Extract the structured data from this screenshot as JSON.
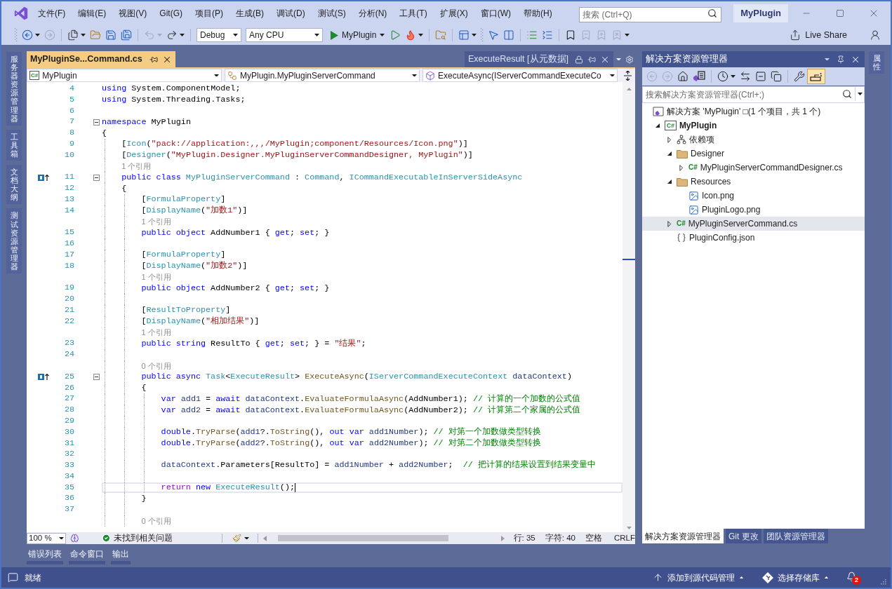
{
  "title_bar": {
    "menu": [
      "文件(F)",
      "编辑(E)",
      "视图(V)",
      "Git(G)",
      "项目(P)",
      "生成(B)",
      "调试(D)",
      "测试(S)",
      "分析(N)",
      "工具(T)",
      "扩展(X)",
      "窗口(W)",
      "帮助(H)"
    ],
    "search": {
      "placeholder": "搜索 (Ctrl+Q)"
    },
    "solution_name": "MyPlugin"
  },
  "toolbar": {
    "groups": [
      {
        "items": [
          {
            "kind": "button",
            "disabled": false,
            "dropdown": true
          },
          {
            "kind": "button",
            "disabled": true,
            "dropdown": false
          }
        ]
      },
      {
        "items": [
          {
            "kind": "button",
            "disabled": false,
            "dropdown": true
          },
          {
            "kind": "button",
            "disabled": false,
            "dropdown": false
          },
          {
            "kind": "button",
            "disabled": false,
            "dropdown": false
          },
          {
            "kind": "button",
            "disabled": false,
            "dropdown": false
          }
        ]
      },
      {
        "items": [
          {
            "kind": "button",
            "disabled": true,
            "dropdown": true
          },
          {
            "kind": "button",
            "disabled": false,
            "dropdown": true
          }
        ]
      },
      {
        "items": [
          {
            "kind": "combo",
            "value": "Debug"
          },
          {
            "kind": "combo",
            "value": "Any CPU"
          },
          {
            "kind": "start",
            "label": "MyPlugin",
            "dropdown": true
          },
          {
            "kind": "button",
            "disabled": false,
            "dropdown": false
          },
          {
            "kind": "button",
            "disabled": false,
            "dropdown": true
          }
        ]
      },
      {
        "items": [
          {
            "kind": "button",
            "disabled": false,
            "dropdown": false
          }
        ]
      },
      {
        "items": [
          {
            "kind": "button",
            "disabled": false,
            "dropdown": true
          }
        ]
      },
      {
        "items": [
          {
            "kind": "button",
            "disabled": false,
            "dropdown": false
          },
          {
            "kind": "button",
            "disabled": false,
            "dropdown": false
          }
        ]
      },
      {
        "items": [
          {
            "kind": "button",
            "disabled": false,
            "dropdown": false
          },
          {
            "kind": "button",
            "disabled": false,
            "dropdown": false
          }
        ]
      },
      {
        "items": [
          {
            "kind": "button",
            "disabled": false,
            "dropdown": false
          },
          {
            "kind": "button",
            "disabled": true,
            "dropdown": false
          },
          {
            "kind": "button",
            "disabled": true,
            "dropdown": false
          },
          {
            "kind": "button",
            "disabled": true,
            "dropdown": false
          }
        ]
      }
    ],
    "live_share": "Live Share"
  },
  "left_tool_tabs": [
    "服务器资源管理器",
    "工具箱",
    "文档大纲",
    "测试资源管理器"
  ],
  "editor": {
    "tabs": [
      {
        "kind": "document",
        "label": "MyPluginSe...Command.cs",
        "selected": true
      },
      {
        "kind": "preview",
        "label": "ExecuteResult [从元数据]",
        "selected": false
      }
    ],
    "navigation": [
      {
        "kind": "project",
        "badge": "C#",
        "value": "MyPlugin"
      },
      {
        "kind": "class",
        "value": "MyPlugin.MyPluginServerCommand"
      },
      {
        "kind": "method",
        "value": "ExecuteAsync(IServerCommandExecuteCo"
      }
    ],
    "lines": [
      {
        "kind": "code",
        "number": "4",
        "segments": [
          {
            "text": "using",
            "kind": "keyword"
          },
          {
            "text": " System.ComponentModel;",
            "kind": "plain"
          }
        ]
      },
      {
        "kind": "code",
        "number": "5",
        "segments": [
          {
            "text": "using",
            "kind": "keyword"
          },
          {
            "text": " System.Threading.Tasks;",
            "kind": "plain"
          }
        ]
      },
      {
        "kind": "code",
        "number": "6"
      },
      {
        "kind": "code",
        "number": "7",
        "expanded": true,
        "segments": [
          {
            "text": "namespace",
            "kind": "keyword"
          },
          {
            "text": " MyPlugin",
            "kind": "plain"
          }
        ]
      },
      {
        "kind": "code",
        "number": "8",
        "segments": [
          {
            "text": "{",
            "kind": "plain"
          }
        ]
      },
      {
        "kind": "code",
        "number": "9",
        "segments": [
          {
            "text": "    [",
            "kind": "plain"
          },
          {
            "text": "Icon",
            "kind": "type"
          },
          {
            "text": "(",
            "kind": "plain"
          },
          {
            "text": "\"pack://application:,,,/MyPlugin;component/Resources/Icon.png\"",
            "kind": "string"
          },
          {
            "text": ")]",
            "kind": "plain"
          }
        ]
      },
      {
        "kind": "code",
        "number": "10",
        "segments": [
          {
            "text": "    [",
            "kind": "plain"
          },
          {
            "text": "Designer",
            "kind": "type"
          },
          {
            "text": "(",
            "kind": "plain"
          },
          {
            "text": "\"MyPlugin.Designer.MyPluginServerCommandDesigner, MyPlugin\"",
            "kind": "string"
          },
          {
            "text": ")]",
            "kind": "plain"
          }
        ]
      },
      {
        "kind": "codelens",
        "text": "1 个引用"
      },
      {
        "kind": "code",
        "number": "11",
        "glyph": true,
        "expanded": true,
        "segments": [
          {
            "text": "    public",
            "kind": "keyword"
          },
          {
            "text": " class",
            "kind": "keyword"
          },
          {
            "text": " MyPluginServerCommand",
            "kind": "type"
          },
          {
            "text": " : ",
            "kind": "plain"
          },
          {
            "text": "Command",
            "kind": "type"
          },
          {
            "text": ", ",
            "kind": "plain"
          },
          {
            "text": "ICommandExecutableInServerSideAsync",
            "kind": "type"
          }
        ]
      },
      {
        "kind": "code",
        "number": "12",
        "segments": [
          {
            "text": "    {",
            "kind": "plain"
          }
        ]
      },
      {
        "kind": "code",
        "number": "13",
        "segments": [
          {
            "text": "        [",
            "kind": "plain"
          },
          {
            "text": "FormulaProperty",
            "kind": "type"
          },
          {
            "text": "]",
            "kind": "plain"
          }
        ]
      },
      {
        "kind": "code",
        "number": "14",
        "segments": [
          {
            "text": "        [",
            "kind": "plain"
          },
          {
            "text": "DisplayName",
            "kind": "type"
          },
          {
            "text": "(",
            "kind": "plain"
          },
          {
            "text": "\"加数1\"",
            "kind": "string"
          },
          {
            "text": ")]",
            "kind": "plain"
          }
        ]
      },
      {
        "kind": "codelens",
        "text": "1 个引用"
      },
      {
        "kind": "code",
        "number": "15",
        "segments": [
          {
            "text": "        public",
            "kind": "keyword"
          },
          {
            "text": " object",
            "kind": "keyword"
          },
          {
            "text": " AddNumber1 { ",
            "kind": "plain"
          },
          {
            "text": "get",
            "kind": "keyword"
          },
          {
            "text": "; ",
            "kind": "plain"
          },
          {
            "text": "set",
            "kind": "keyword"
          },
          {
            "text": "; }",
            "kind": "plain"
          }
        ]
      },
      {
        "kind": "code",
        "number": "16"
      },
      {
        "kind": "code",
        "number": "17",
        "segments": [
          {
            "text": "        [",
            "kind": "plain"
          },
          {
            "text": "FormulaProperty",
            "kind": "type"
          },
          {
            "text": "]",
            "kind": "plain"
          }
        ]
      },
      {
        "kind": "code",
        "number": "18",
        "segments": [
          {
            "text": "        [",
            "kind": "plain"
          },
          {
            "text": "DisplayName",
            "kind": "type"
          },
          {
            "text": "(",
            "kind": "plain"
          },
          {
            "text": "\"加数2\"",
            "kind": "string"
          },
          {
            "text": ")]",
            "kind": "plain"
          }
        ]
      },
      {
        "kind": "codelens",
        "text": "1 个引用"
      },
      {
        "kind": "code",
        "number": "19",
        "segments": [
          {
            "text": "        public",
            "kind": "keyword"
          },
          {
            "text": " object",
            "kind": "keyword"
          },
          {
            "text": " AddNumber2 { ",
            "kind": "plain"
          },
          {
            "text": "get",
            "kind": "keyword"
          },
          {
            "text": "; ",
            "kind": "plain"
          },
          {
            "text": "set",
            "kind": "keyword"
          },
          {
            "text": "; }",
            "kind": "plain"
          }
        ]
      },
      {
        "kind": "code",
        "number": "20"
      },
      {
        "kind": "code",
        "number": "21",
        "segments": [
          {
            "text": "        [",
            "kind": "plain"
          },
          {
            "text": "ResultToProperty",
            "kind": "type"
          },
          {
            "text": "]",
            "kind": "plain"
          }
        ]
      },
      {
        "kind": "code",
        "number": "22",
        "segments": [
          {
            "text": "        [",
            "kind": "plain"
          },
          {
            "text": "DisplayName",
            "kind": "type"
          },
          {
            "text": "(",
            "kind": "plain"
          },
          {
            "text": "\"相加结果\"",
            "kind": "string"
          },
          {
            "text": ")]",
            "kind": "plain"
          }
        ]
      },
      {
        "kind": "codelens",
        "text": "1 个引用"
      },
      {
        "kind": "code",
        "number": "23",
        "segments": [
          {
            "text": "        public",
            "kind": "keyword"
          },
          {
            "text": " string",
            "kind": "keyword"
          },
          {
            "text": " ResultTo { ",
            "kind": "plain"
          },
          {
            "text": "get",
            "kind": "keyword"
          },
          {
            "text": "; ",
            "kind": "plain"
          },
          {
            "text": "set",
            "kind": "keyword"
          },
          {
            "text": "; } = ",
            "kind": "plain"
          },
          {
            "text": "\"结果\"",
            "kind": "string"
          },
          {
            "text": ";",
            "kind": "plain"
          }
        ]
      },
      {
        "kind": "code",
        "number": "24"
      },
      {
        "kind": "codelens",
        "text": "0 个引用"
      },
      {
        "kind": "code",
        "number": "25",
        "glyph": true,
        "expanded": true,
        "segments": [
          {
            "text": "        public",
            "kind": "keyword"
          },
          {
            "text": " async",
            "kind": "keyword"
          },
          {
            "text": " Task",
            "kind": "type"
          },
          {
            "text": "<",
            "kind": "plain"
          },
          {
            "text": "ExecuteResult",
            "kind": "type"
          },
          {
            "text": "> ",
            "kind": "plain"
          },
          {
            "text": "ExecuteAsync",
            "kind": "method"
          },
          {
            "text": "(",
            "kind": "plain"
          },
          {
            "text": "IServerCommandExecuteContext",
            "kind": "type"
          },
          {
            "text": " dataContext",
            "kind": "variable"
          },
          {
            "text": ")",
            "kind": "plain"
          }
        ]
      },
      {
        "kind": "code",
        "number": "26",
        "segments": [
          {
            "text": "        {",
            "kind": "plain"
          }
        ]
      },
      {
        "kind": "code",
        "number": "27",
        "segments": [
          {
            "text": "            var",
            "kind": "keyword"
          },
          {
            "text": " add1",
            "kind": "variable"
          },
          {
            "text": " = ",
            "kind": "plain"
          },
          {
            "text": "await",
            "kind": "keyword"
          },
          {
            "text": " dataContext",
            "kind": "variable"
          },
          {
            "text": ".",
            "kind": "plain"
          },
          {
            "text": "EvaluateFormulaAsync",
            "kind": "method"
          },
          {
            "text": "(AddNumber1); ",
            "kind": "plain"
          },
          {
            "text": "// 计算的一个加数的公式值",
            "kind": "comment"
          }
        ]
      },
      {
        "kind": "code",
        "number": "28",
        "segments": [
          {
            "text": "            var",
            "kind": "keyword"
          },
          {
            "text": " add2",
            "kind": "variable"
          },
          {
            "text": " = ",
            "kind": "plain"
          },
          {
            "text": "await",
            "kind": "keyword"
          },
          {
            "text": " dataContext",
            "kind": "variable"
          },
          {
            "text": ".",
            "kind": "plain"
          },
          {
            "text": "EvaluateFormulaAsync",
            "kind": "method"
          },
          {
            "text": "(AddNumber2); ",
            "kind": "plain"
          },
          {
            "text": "// 计算第二个家属的公式值",
            "kind": "comment"
          }
        ]
      },
      {
        "kind": "code",
        "number": "29"
      },
      {
        "kind": "code",
        "number": "30",
        "segments": [
          {
            "text": "            double",
            "kind": "keyword"
          },
          {
            "text": ".",
            "kind": "plain"
          },
          {
            "text": "TryParse",
            "kind": "method"
          },
          {
            "text": "(",
            "kind": "plain"
          },
          {
            "text": "add1",
            "kind": "variable"
          },
          {
            "text": "?.",
            "kind": "plain"
          },
          {
            "text": "ToString",
            "kind": "method"
          },
          {
            "text": "(), ",
            "kind": "plain"
          },
          {
            "text": "out",
            "kind": "keyword"
          },
          {
            "text": " var",
            "kind": "keyword"
          },
          {
            "text": " add1Number",
            "kind": "variable"
          },
          {
            "text": "); ",
            "kind": "plain"
          },
          {
            "text": "// 对第一个加数做类型转换",
            "kind": "comment"
          }
        ]
      },
      {
        "kind": "code",
        "number": "31",
        "segments": [
          {
            "text": "            double",
            "kind": "keyword"
          },
          {
            "text": ".",
            "kind": "plain"
          },
          {
            "text": "TryParse",
            "kind": "method"
          },
          {
            "text": "(",
            "kind": "plain"
          },
          {
            "text": "add2",
            "kind": "variable"
          },
          {
            "text": "?.",
            "kind": "plain"
          },
          {
            "text": "ToString",
            "kind": "method"
          },
          {
            "text": "(), ",
            "kind": "plain"
          },
          {
            "text": "out",
            "kind": "keyword"
          },
          {
            "text": " var",
            "kind": "keyword"
          },
          {
            "text": " add2Number",
            "kind": "variable"
          },
          {
            "text": "); ",
            "kind": "plain"
          },
          {
            "text": "// 对第二个加数做类型转换",
            "kind": "comment"
          }
        ]
      },
      {
        "kind": "code",
        "number": "32"
      },
      {
        "kind": "code",
        "number": "33",
        "segments": [
          {
            "text": "            dataContext",
            "kind": "variable"
          },
          {
            "text": ".Parameters[ResultTo] = ",
            "kind": "plain"
          },
          {
            "text": "add1Number",
            "kind": "variable"
          },
          {
            "text": " + ",
            "kind": "plain"
          },
          {
            "text": "add2Number",
            "kind": "variable"
          },
          {
            "text": ";  ",
            "kind": "plain"
          },
          {
            "text": "// 把计算的结果设置到结果变量中",
            "kind": "comment"
          }
        ]
      },
      {
        "kind": "code",
        "number": "34"
      },
      {
        "kind": "code",
        "number": "35",
        "current": true,
        "segments": [
          {
            "text": "            return",
            "kind": "control"
          },
          {
            "text": " new",
            "kind": "keyword"
          },
          {
            "text": " ExecuteResult",
            "kind": "type"
          },
          {
            "text": "();",
            "kind": "plain"
          }
        ]
      },
      {
        "kind": "code",
        "number": "36",
        "segments": [
          {
            "text": "        }",
            "kind": "plain"
          }
        ]
      },
      {
        "kind": "code",
        "number": "37"
      },
      {
        "kind": "codelens",
        "text": "0 个引用"
      }
    ],
    "status": {
      "zoom": "100 %",
      "issues": "未找到相关问题",
      "line": "行: 35",
      "column": "字符: 40",
      "indentation": "空格",
      "line_ending": "CRLF"
    }
  },
  "solution_explorer": {
    "title": "解决方案资源管理器",
    "toolbar": {
      "groups": [
        {
          "items": [
            {
              "disabled": true,
              "dropdown": false
            },
            {
              "disabled": true,
              "dropdown": false
            },
            {
              "disabled": false,
              "dropdown": false
            },
            {
              "disabled": false,
              "dropdown": false
            }
          ]
        },
        {
          "items": [
            {
              "disabled": false,
              "dropdown": true
            },
            {
              "disabled": false,
              "dropdown": false
            },
            {
              "disabled": false,
              "dropdown": false
            },
            {
              "disabled": false,
              "dropdown": false
            }
          ]
        },
        {
          "items": [
            {
              "disabled": false,
              "dropdown": false
            },
            {
              "disabled": false,
              "dropdown": false,
              "on": true
            }
          ]
        }
      ]
    },
    "search": {
      "placeholder": "搜索解决方案资源管理器(Ctrl+;)"
    },
    "tree": [
      {
        "kind": "solution",
        "label": "解决方案 'MyPlugin' □(1 个项目，共 1 个)",
        "selected": false,
        "children": [
          {
            "kind": "project",
            "badge": "C#",
            "label": "MyPlugin",
            "expanded": true,
            "selected": false,
            "children": [
              {
                "kind": "dependencies",
                "label": "依赖项",
                "expanded": false,
                "selected": false
              },
              {
                "kind": "folder",
                "label": "Designer",
                "expanded": true,
                "selected": false,
                "children": [
                  {
                    "kind": "csharp",
                    "badge": "C#",
                    "label": "MyPluginServerCommandDesigner.cs",
                    "expanded": false,
                    "selected": false
                  }
                ]
              },
              {
                "kind": "folder",
                "label": "Resources",
                "expanded": true,
                "selected": false,
                "children": [
                  {
                    "kind": "image",
                    "label": "Icon.png",
                    "selected": false
                  },
                  {
                    "kind": "image",
                    "label": "PluginLogo.png",
                    "selected": false
                  }
                ]
              },
              {
                "kind": "csharp",
                "badge": "C#",
                "label": "MyPluginServerCommand.cs",
                "expanded": false,
                "selected": true
              },
              {
                "kind": "json",
                "label": "PluginConfig.json",
                "selected": false
              }
            ]
          }
        ]
      }
    ],
    "tabs": [
      {
        "label": "解决方案资源管理器",
        "selected": true
      },
      {
        "label": "Git 更改",
        "selected": false
      },
      {
        "label": "团队资源管理器",
        "selected": false
      }
    ]
  },
  "right_tool_tabs": [
    "属性"
  ],
  "bottom_tool_tabs": [
    "错误列表",
    "命令窗口",
    "输出"
  ],
  "status_bar": {
    "message": "就绪",
    "source_control": "添加到源代码管理",
    "repository": "选择存储库",
    "notifications": "2"
  }
}
